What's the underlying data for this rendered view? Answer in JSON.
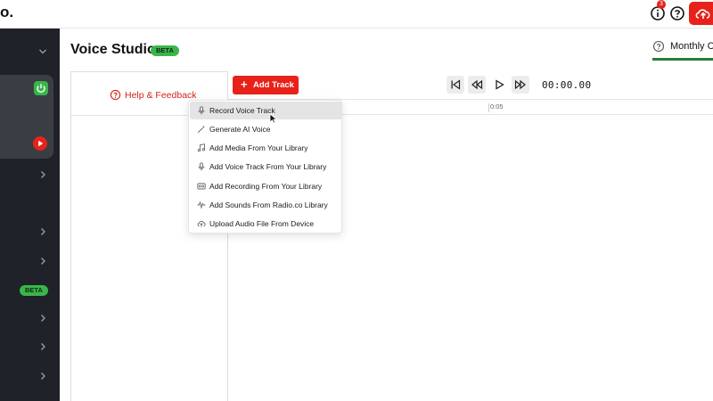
{
  "app": {
    "brand_text": "o.",
    "notification_count": "3"
  },
  "header": {
    "title": "Voice Studio",
    "beta_badge": "BETA",
    "monthly_label": "Monthly Cr"
  },
  "sidebar": {
    "beta_badge": "BETA"
  },
  "editor": {
    "help_feedback_label": "Help & Feedback",
    "add_track_label": "Add Track",
    "timecode": "00:00.00",
    "ruler_tick": "0:05"
  },
  "menu": {
    "items": [
      {
        "label": "Record Voice Track",
        "icon": "microphone-icon"
      },
      {
        "label": "Generate AI Voice",
        "icon": "magic-wand-icon"
      },
      {
        "label": "Add Media From Your Library",
        "icon": "music-note-icon"
      },
      {
        "label": "Add Voice Track From Your Library",
        "icon": "microphone-icon"
      },
      {
        "label": "Add Recording From Your Library",
        "icon": "recording-icon"
      },
      {
        "label": "Add Sounds From Radio.co Library",
        "icon": "waveform-icon"
      },
      {
        "label": "Upload Audio File From Device",
        "icon": "cloud-upload-icon"
      }
    ]
  },
  "colors": {
    "accent_red": "#e8211a",
    "beta_green": "#3bb54a",
    "sidebar_bg": "#1f2228"
  }
}
